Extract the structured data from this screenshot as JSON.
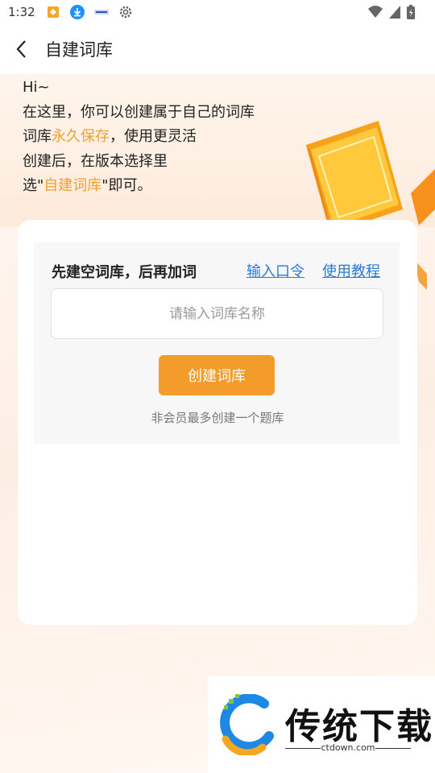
{
  "status_bar": {
    "time": "1:32",
    "icons": [
      "taobao-app-icon",
      "download-icon",
      "app-badge-icon",
      "settings-gear-icon"
    ],
    "right_icons": [
      "wifi-icon",
      "signal-icon",
      "battery-charging-icon"
    ]
  },
  "header": {
    "title": "自建词库",
    "back_icon": "chevron-left-icon"
  },
  "intro": {
    "greeting": "Hi~",
    "line1": "在这里，你可以创建属于自己的词库",
    "line2_prefix": "词库",
    "line2_highlight": "永久保存",
    "line2_suffix": "，使用更灵活",
    "line3": "创建后，在版本选择里",
    "line4_prefix": "选\"",
    "line4_highlight": "自建词库",
    "line4_suffix": "\"即可。"
  },
  "card": {
    "panel_title": "先建空词库，后再加词",
    "link_code": "输入口令",
    "link_tutorial": "使用教程",
    "input_placeholder": "请输入词库名称",
    "input_value": "",
    "create_button": "创建词库",
    "note": "非会员最多创建一个题库"
  },
  "watermark": {
    "brand": "传统下载",
    "domain": "ctdown.com"
  },
  "colors": {
    "accent_orange": "#f39c2c",
    "highlight_text": "#f0a030",
    "link_blue": "#2a7ad8"
  }
}
